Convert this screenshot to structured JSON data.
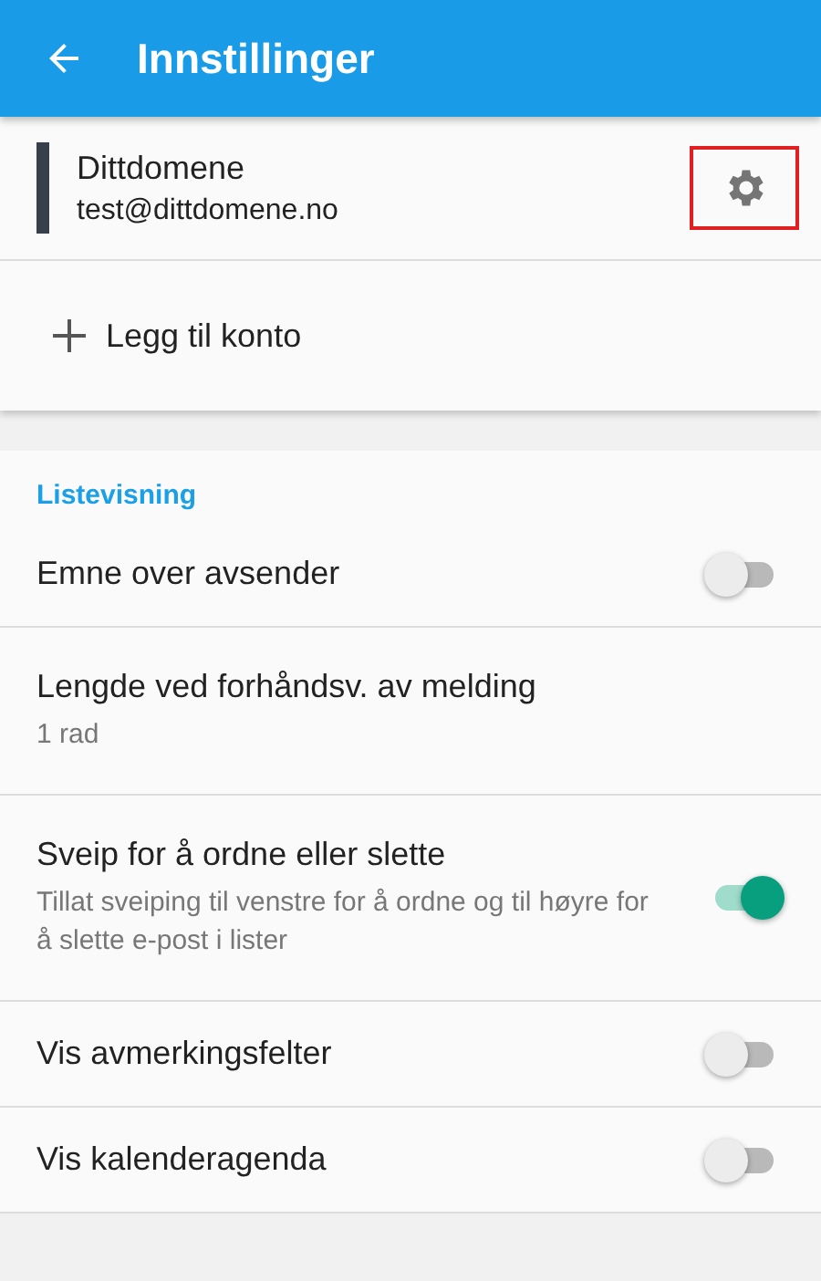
{
  "app_bar": {
    "title": "Innstillinger"
  },
  "account": {
    "name": "Dittdomene",
    "email": "test@dittdomene.no",
    "color": "#37404a",
    "settings_highlighted": true
  },
  "add_account": {
    "label": "Legg til konto"
  },
  "section": {
    "title": "Listevisning"
  },
  "settings": [
    {
      "kind": "toggle",
      "title": "Emne over avsender",
      "on": false
    },
    {
      "kind": "value",
      "title": "Lengde ved forhåndsv. av melding",
      "summary": "1 rad"
    },
    {
      "kind": "toggle",
      "title": "Sveip for å ordne eller slette",
      "summary": "Tillat sveiping til venstre for å ordne og til høyre for å slette e-post i lister",
      "on": true
    },
    {
      "kind": "toggle",
      "title": "Vis avmerkingsfelter",
      "on": false
    },
    {
      "kind": "toggle",
      "title": "Vis kalenderagenda",
      "on": false
    }
  ]
}
